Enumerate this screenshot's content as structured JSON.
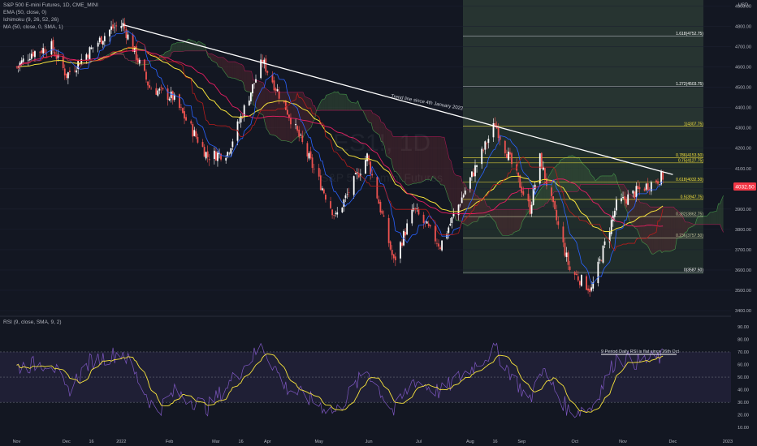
{
  "header": {
    "symbol": "S&P 500 E-mini Futures, 1D, CME_MINI",
    "indicators": [
      "EMA (50, close, 0)",
      "Ichimoku (9, 26, 52, 26)",
      "MA (50, close, 0, SMA, 1)"
    ],
    "currency": "USD",
    "watermark_ticker": "ES1!, 1D",
    "watermark_name": "S&P 500 E-mini Futures"
  },
  "rsi_legend": "RSI (9, close, SMA, 9, 2)",
  "annotations": {
    "trend": "Trend line since 4th January 2022",
    "rsi": "9 Period Daily RSI is flat since 26th Oct"
  },
  "price_badge": "4032.50",
  "colors": {
    "background": "#131722",
    "up": "#ffffff",
    "down": "#ef5350",
    "fib_zone": "#2a3a35",
    "ema": "#f7e33b",
    "ma": "#e91e63",
    "tenkan": "#2962ff",
    "kijun": "#b71c1c",
    "rsi_line": "#7e57c2",
    "rsi_ma": "#f7e33b",
    "badge": "#f23645"
  },
  "chart_data": [
    {
      "type": "candlestick",
      "title": "S&P 500 E-mini Futures, 1D, CME_MINI",
      "y_axis": {
        "ticks": [
          3400,
          3500,
          3600,
          3700,
          3800,
          3900,
          4000,
          4100,
          4200,
          4300,
          4400,
          4500,
          4600,
          4700,
          4800,
          4900
        ],
        "ylim": [
          3380,
          4930
        ],
        "unit": "USD"
      },
      "x_ticks": [
        "Nov",
        "Dec",
        "16",
        "2022",
        "Feb",
        "Mar",
        "16",
        "Apr",
        "May",
        "Jun",
        "Jul",
        "Aug",
        "16",
        "Sep",
        "Oct",
        "Nov",
        "Dec",
        "2023"
      ],
      "price_path": [
        [
          "2021-11-01",
          4600
        ],
        [
          "2021-11-10",
          4670
        ],
        [
          "2021-11-22",
          4700
        ],
        [
          "2021-12-01",
          4560
        ],
        [
          "2021-12-15",
          4680
        ],
        [
          "2021-12-28",
          4790
        ],
        [
          "2022-01-04",
          4808
        ],
        [
          "2022-01-20",
          4500
        ],
        [
          "2022-02-03",
          4450
        ],
        [
          "2022-02-24",
          4160
        ],
        [
          "2022-03-08",
          4180
        ],
        [
          "2022-03-29",
          4630
        ],
        [
          "2022-04-12",
          4400
        ],
        [
          "2022-05-12",
          3860
        ],
        [
          "2022-05-31",
          4160
        ],
        [
          "2022-06-16",
          3640
        ],
        [
          "2022-06-28",
          3900
        ],
        [
          "2022-07-14",
          3720
        ],
        [
          "2022-08-16",
          4320
        ],
        [
          "2022-09-06",
          3900
        ],
        [
          "2022-09-12",
          4150
        ],
        [
          "2022-09-30",
          3600
        ],
        [
          "2022-10-13",
          3502
        ],
        [
          "2022-10-28",
          3920
        ],
        [
          "2022-11-10",
          3990
        ],
        [
          "2022-11-25",
          4060
        ]
      ],
      "fibonacci": [
        {
          "label": "1.618(4752.75)",
          "value": 4752.75
        },
        {
          "label": "1.272(4503.75)",
          "value": 4503.75
        },
        {
          "label": "1(4307.75)",
          "value": 4307.75
        },
        {
          "label": "0.786(4153.50)",
          "value": 4153.5
        },
        {
          "label": "0.75(4127.75)",
          "value": 4127.75
        },
        {
          "label": "0.618(4032.50)",
          "value": 4032.5
        },
        {
          "label": "0.5(3947.75)",
          "value": 3947.75
        },
        {
          "label": "0.382(3862.75)",
          "value": 3862.75
        },
        {
          "label": "0.236(3757.50)",
          "value": 3757.5
        },
        {
          "label": "0(3587.50)",
          "value": 3587.5
        }
      ],
      "trendline": [
        [
          "2022-01-04",
          4808
        ],
        [
          "2022-12-01",
          4070
        ]
      ],
      "last_price": 4032.5
    },
    {
      "type": "line",
      "title": "RSI (9, close, SMA, 9, 2)",
      "y_axis": {
        "ticks": [
          10,
          20,
          30,
          40,
          50,
          60,
          70,
          80,
          90
        ],
        "ylim": [
          5,
          97
        ]
      },
      "band": [
        30,
        70
      ],
      "rsi_path": [
        [
          "2021-11-01",
          58
        ],
        [
          "2021-11-22",
          62
        ],
        [
          "2021-12-01",
          38
        ],
        [
          "2021-12-15",
          62
        ],
        [
          "2022-01-04",
          70
        ],
        [
          "2022-01-24",
          22
        ],
        [
          "2022-02-04",
          38
        ],
        [
          "2022-02-24",
          26
        ],
        [
          "2022-03-29",
          75
        ],
        [
          "2022-04-12",
          42
        ],
        [
          "2022-05-12",
          22
        ],
        [
          "2022-05-31",
          56
        ],
        [
          "2022-06-16",
          22
        ],
        [
          "2022-06-28",
          48
        ],
        [
          "2022-07-14",
          38
        ],
        [
          "2022-08-16",
          72
        ],
        [
          "2022-09-06",
          30
        ],
        [
          "2022-09-12",
          58
        ],
        [
          "2022-09-30",
          22
        ],
        [
          "2022-10-13",
          26
        ],
        [
          "2022-10-28",
          65
        ],
        [
          "2022-11-10",
          62
        ],
        [
          "2022-11-25",
          66
        ]
      ]
    }
  ]
}
